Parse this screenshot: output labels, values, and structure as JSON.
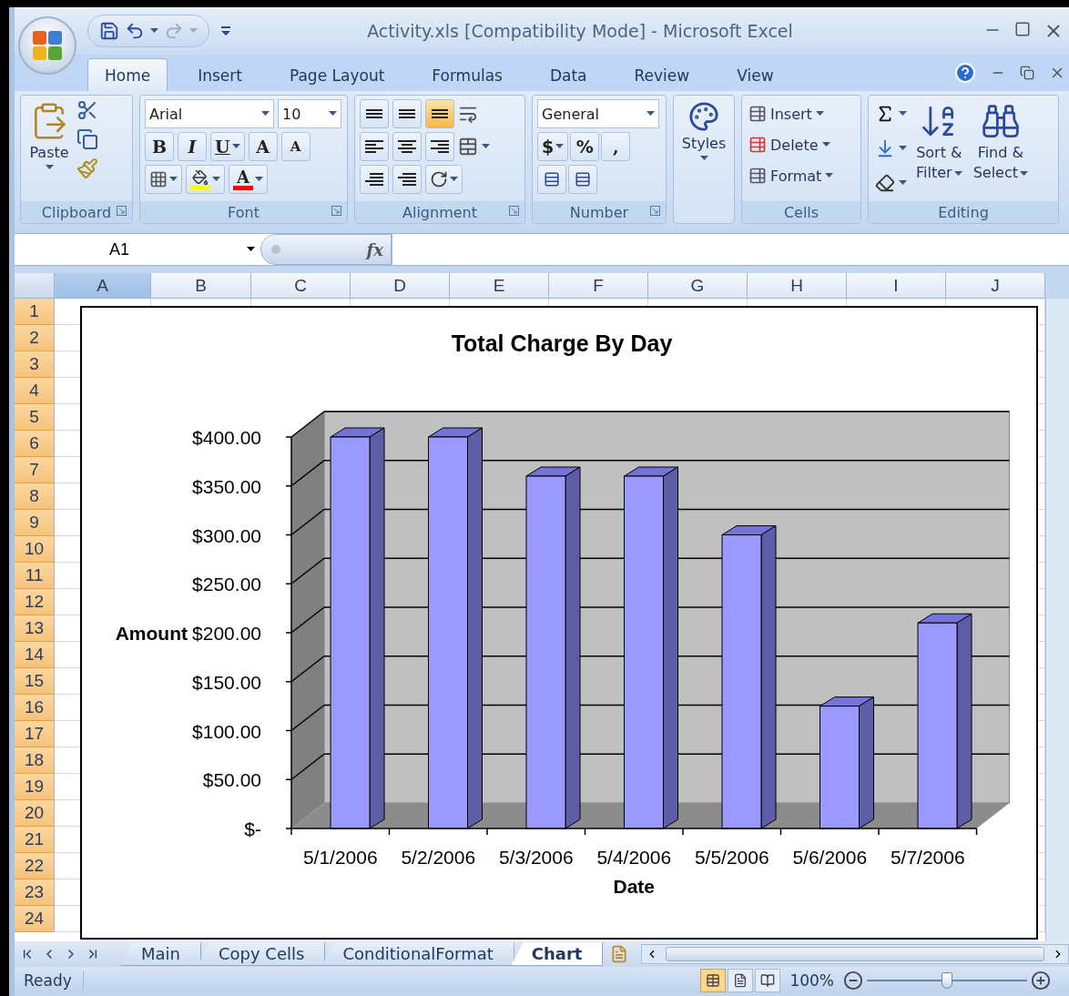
{
  "window": {
    "title": "Activity.xls  [Compatibility Mode] - Microsoft Excel"
  },
  "ribbon_tabs": [
    {
      "label": "Home",
      "selected": true
    },
    {
      "label": "Insert",
      "selected": false
    },
    {
      "label": "Page Layout",
      "selected": false
    },
    {
      "label": "Formulas",
      "selected": false
    },
    {
      "label": "Data",
      "selected": false
    },
    {
      "label": "Review",
      "selected": false
    },
    {
      "label": "View",
      "selected": false
    }
  ],
  "clipboard": {
    "label": "Clipboard",
    "paste": "Paste"
  },
  "font": {
    "label": "Font",
    "name": "Arial",
    "size": "10",
    "bold": "B",
    "italic": "I",
    "underline": "U",
    "grow": "A",
    "shrink": "A",
    "text_color_glyph": "A"
  },
  "alignment": {
    "label": "Alignment",
    "vertical": [
      {
        "selected": false
      },
      {
        "selected": false
      },
      {
        "selected": true
      }
    ]
  },
  "number": {
    "label": "Number",
    "format": "General",
    "currency": "$",
    "percent": "%",
    "comma": ","
  },
  "styles": {
    "label": "Styles"
  },
  "cells": {
    "label": "Cells",
    "buttons": [
      "Insert",
      "Delete",
      "Format"
    ]
  },
  "editing": {
    "label": "Editing",
    "sort": [
      "Sort &",
      "Filter"
    ],
    "find": [
      "Find &",
      "Select"
    ]
  },
  "formula_bar": {
    "name_box": "A1",
    "function_label": "fx"
  },
  "columns": [
    {
      "label": "A",
      "selected": true
    },
    {
      "label": "B",
      "selected": false
    },
    {
      "label": "C",
      "selected": false
    },
    {
      "label": "D",
      "selected": false
    },
    {
      "label": "E",
      "selected": false
    },
    {
      "label": "F",
      "selected": false
    },
    {
      "label": "G",
      "selected": false
    },
    {
      "label": "H",
      "selected": false
    },
    {
      "label": "I",
      "selected": false
    },
    {
      "label": "J",
      "selected": false
    }
  ],
  "rows": [
    {
      "label": "1",
      "selected": true
    },
    {
      "label": "2",
      "selected": true
    },
    {
      "label": "3",
      "selected": true
    },
    {
      "label": "4",
      "selected": true
    },
    {
      "label": "5",
      "selected": true
    },
    {
      "label": "6",
      "selected": true
    },
    {
      "label": "7",
      "selected": true
    },
    {
      "label": "8",
      "selected": true
    },
    {
      "label": "9",
      "selected": true
    },
    {
      "label": "10",
      "selected": true
    },
    {
      "label": "11",
      "selected": true
    },
    {
      "label": "12",
      "selected": true
    },
    {
      "label": "13",
      "selected": true
    },
    {
      "label": "14",
      "selected": true
    },
    {
      "label": "15",
      "selected": true
    },
    {
      "label": "16",
      "selected": true
    },
    {
      "label": "17",
      "selected": true
    },
    {
      "label": "18",
      "selected": true
    },
    {
      "label": "19",
      "selected": true
    },
    {
      "label": "20",
      "selected": true
    },
    {
      "label": "21",
      "selected": true
    },
    {
      "label": "22",
      "selected": true
    },
    {
      "label": "23",
      "selected": true
    },
    {
      "label": "24",
      "selected": true
    }
  ],
  "chart": {
    "chart_data": {
      "type": "bar",
      "title": "Total Charge By Day",
      "xlabel": "Date",
      "ylabel": "Amount",
      "categories": [
        "5/1/2006",
        "5/2/2006",
        "5/3/2006",
        "5/4/2006",
        "5/5/2006",
        "5/6/2006",
        "5/7/2006"
      ],
      "values": [
        400,
        400,
        360,
        360,
        300,
        125,
        210
      ],
      "ylim": [
        0,
        400
      ],
      "yticks": [
        {
          "value": 0,
          "label": "$-"
        },
        {
          "value": 50,
          "label": "$50.00"
        },
        {
          "value": 100,
          "label": "$100.00"
        },
        {
          "value": 150,
          "label": "$150.00"
        },
        {
          "value": 200,
          "label": "$200.00"
        },
        {
          "value": 250,
          "label": "$250.00"
        },
        {
          "value": 300,
          "label": "$300.00"
        },
        {
          "value": 350,
          "label": "$350.00"
        },
        {
          "value": 400,
          "label": "$400.00"
        }
      ]
    }
  },
  "sheet_tabs": [
    {
      "label": "Main",
      "selected": false
    },
    {
      "label": "Copy Cells",
      "selected": false
    },
    {
      "label": "ConditionalFormat",
      "selected": false
    },
    {
      "label": "Chart",
      "selected": true
    }
  ],
  "status_bar": {
    "status": "Ready",
    "views": [
      {
        "selected": true
      },
      {
        "selected": false
      },
      {
        "selected": false
      }
    ],
    "zoom": "100%",
    "zoom_slider": {
      "level": 0.5
    }
  }
}
